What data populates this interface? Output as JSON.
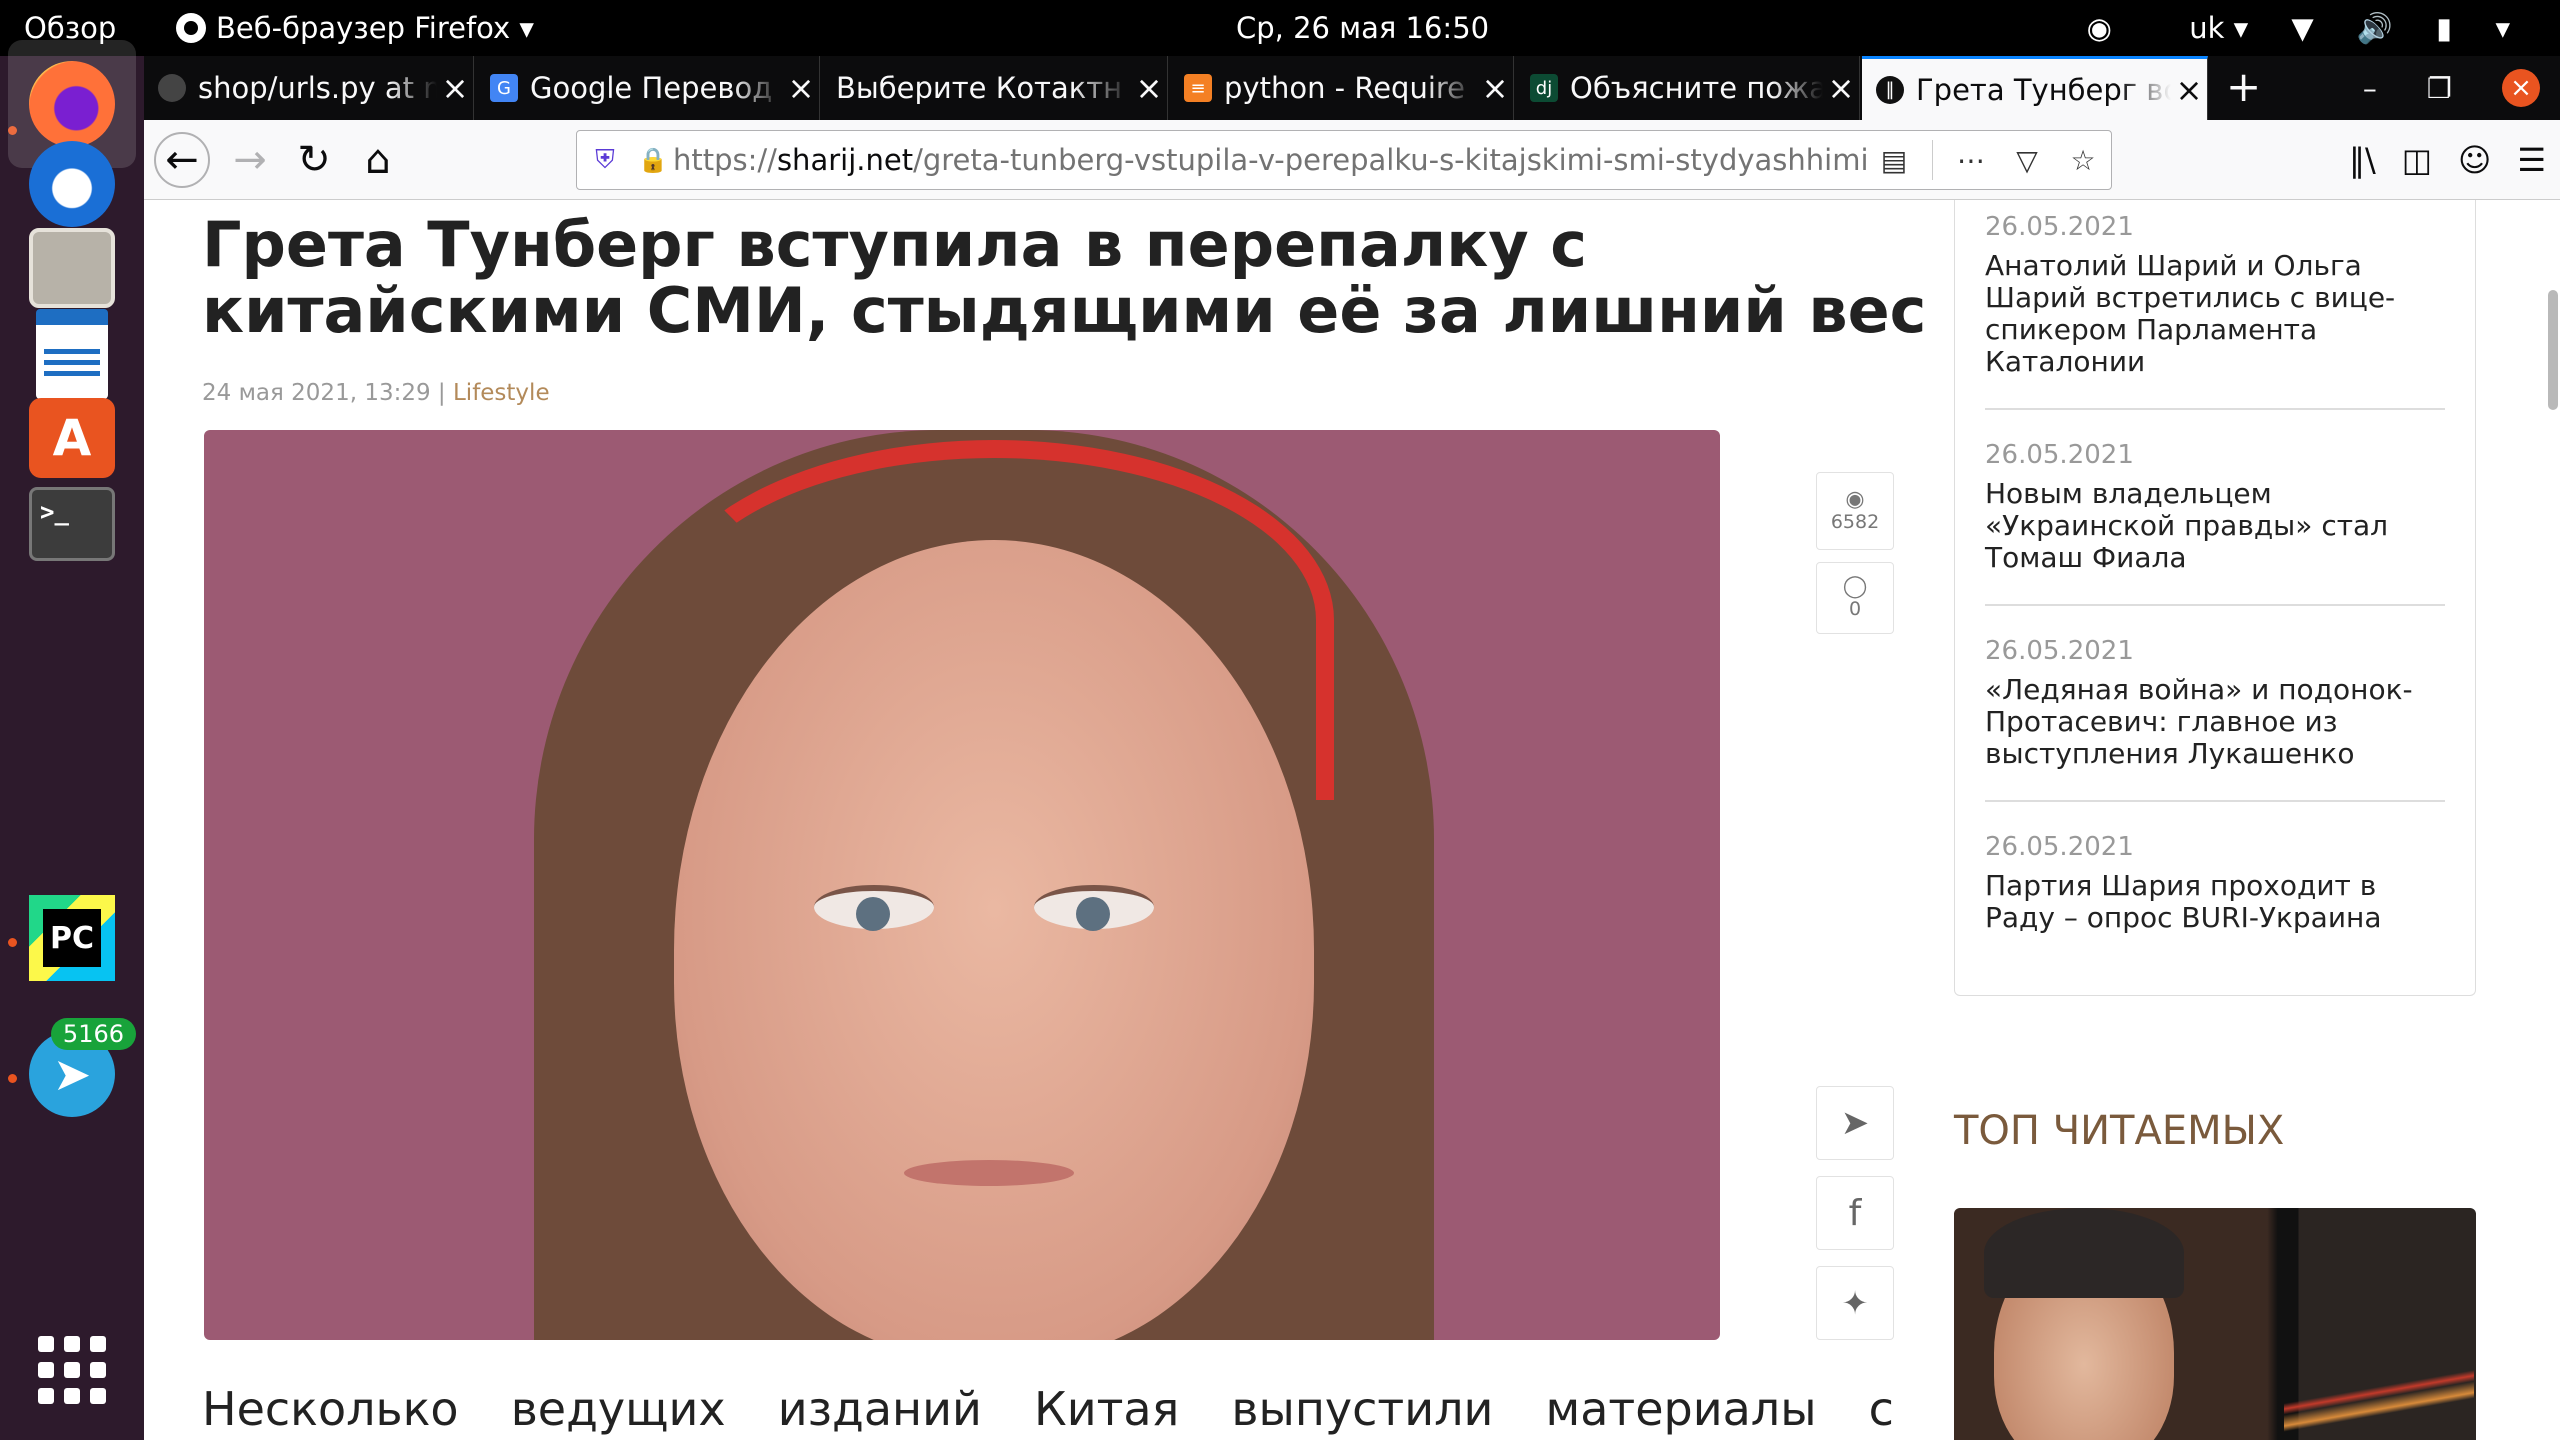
{
  "topbar": {
    "activities": "Обзор",
    "app_name": "Веб-браузер Firefox",
    "clock": "Ср, 26 мая  16:50",
    "keyboard_layout": "uk"
  },
  "dock": {
    "telegram_badge": "5166",
    "terminal_prompt": ">_",
    "pycharm_label": "PC"
  },
  "tabs": [
    {
      "label": "shop/urls.py at m"
    },
    {
      "label": "Google Перевод"
    },
    {
      "label": "Выберите Котактн"
    },
    {
      "label": "python - Require"
    },
    {
      "label": "Объясните пожа"
    },
    {
      "label": "Грета Тунберг вс"
    }
  ],
  "navbar": {
    "url_scheme": "https://",
    "url_host": "sharij.net",
    "url_path": "/greta-tunberg-vstupila-v-perepalku-s-kitajskimi-smi-stydyashhimi-e"
  },
  "article": {
    "headline": "Грета Тунберг вступила в перепалку с китайскими СМИ, стыдящими её за лишний вес",
    "date": "24 мая 2021, 13:29",
    "separator": "|",
    "category": "Lifestyle",
    "views": "6582",
    "comments": "0",
    "lead_words": [
      "Несколько",
      "ведущих",
      "изданий",
      "Китая",
      "выпустили",
      "материалы",
      "с"
    ]
  },
  "sidebar": {
    "news": [
      {
        "date": "26.05.2021",
        "title": "Анатолий Шарий и Ольга Шарий встретились с вице-спикером Парламента Каталонии"
      },
      {
        "date": "26.05.2021",
        "title": "Новым владельцем «Украинской правды» стал Томаш Фиала"
      },
      {
        "date": "26.05.2021",
        "title": "«Ледяная война» и подонок-Протасевич: главное из выступления Лукашенко"
      },
      {
        "date": "26.05.2021",
        "title": "Партия Шария проходит в Раду – опрос BURI-Украина"
      }
    ],
    "top_read_heading": "ТОП ЧИТАЕМЫХ"
  },
  "colors": {
    "ubuntu_orange": "#e95420",
    "firefox_accent": "#0a84ff",
    "category_link": "#b38a5a",
    "top_read_heading": "#7a5a3c"
  }
}
